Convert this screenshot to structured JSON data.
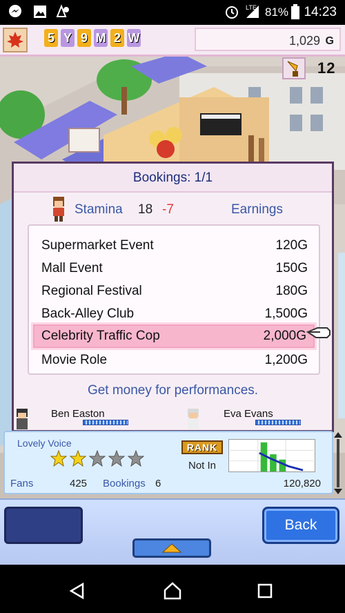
{
  "status_bar": {
    "time": "14:23",
    "battery_percent": "81%",
    "network_label": "LTE",
    "icons": [
      "messenger-icon",
      "gallery-icon",
      "map-pin-icon",
      "alarm-icon",
      "signal-icon",
      "battery-icon"
    ]
  },
  "hud": {
    "date_glyphs": [
      "5",
      "Y",
      "9",
      "M",
      "2",
      "W"
    ],
    "money": "1,029",
    "money_unit": "G",
    "trophy_count": "12",
    "colors": {
      "hud_bg": "#f5e9f3",
      "accent": "#e2b7d4"
    }
  },
  "modal": {
    "title": "Bookings: 1/1",
    "stamina_label": "Stamina",
    "stamina_value": "18",
    "stamina_cost": "-7",
    "earnings_label": "Earnings",
    "jobs": [
      {
        "name": "Supermarket Event",
        "price": "120G",
        "selected": false
      },
      {
        "name": "Mall Event",
        "price": "150G",
        "selected": false
      },
      {
        "name": "Regional Festival",
        "price": "180G",
        "selected": false
      },
      {
        "name": "Back-Alley Club",
        "price": "1,500G",
        "selected": false
      },
      {
        "name": "Celebrity Traffic Cop",
        "price": "2,000G",
        "selected": true
      },
      {
        "name": "Movie Role",
        "price": "1,200G",
        "selected": false
      }
    ],
    "hint": "Get money for performances."
  },
  "characters": [
    {
      "name": "Ben Easton"
    },
    {
      "name": "Eva Evans"
    }
  ],
  "info": {
    "skill_name": "Lovely Voice",
    "stars_filled": 2,
    "stars_total": 5,
    "rank_badge": "RANK",
    "rank_value": "Not In",
    "fans_label": "Fans",
    "fans_value": "425",
    "bookings_label": "Bookings",
    "bookings_value": "6",
    "money_total": "120,820"
  },
  "actions": {
    "back_label": "Back"
  },
  "navbar": {
    "icons": [
      "back-triangle-icon",
      "home-icon",
      "recents-icon"
    ]
  }
}
